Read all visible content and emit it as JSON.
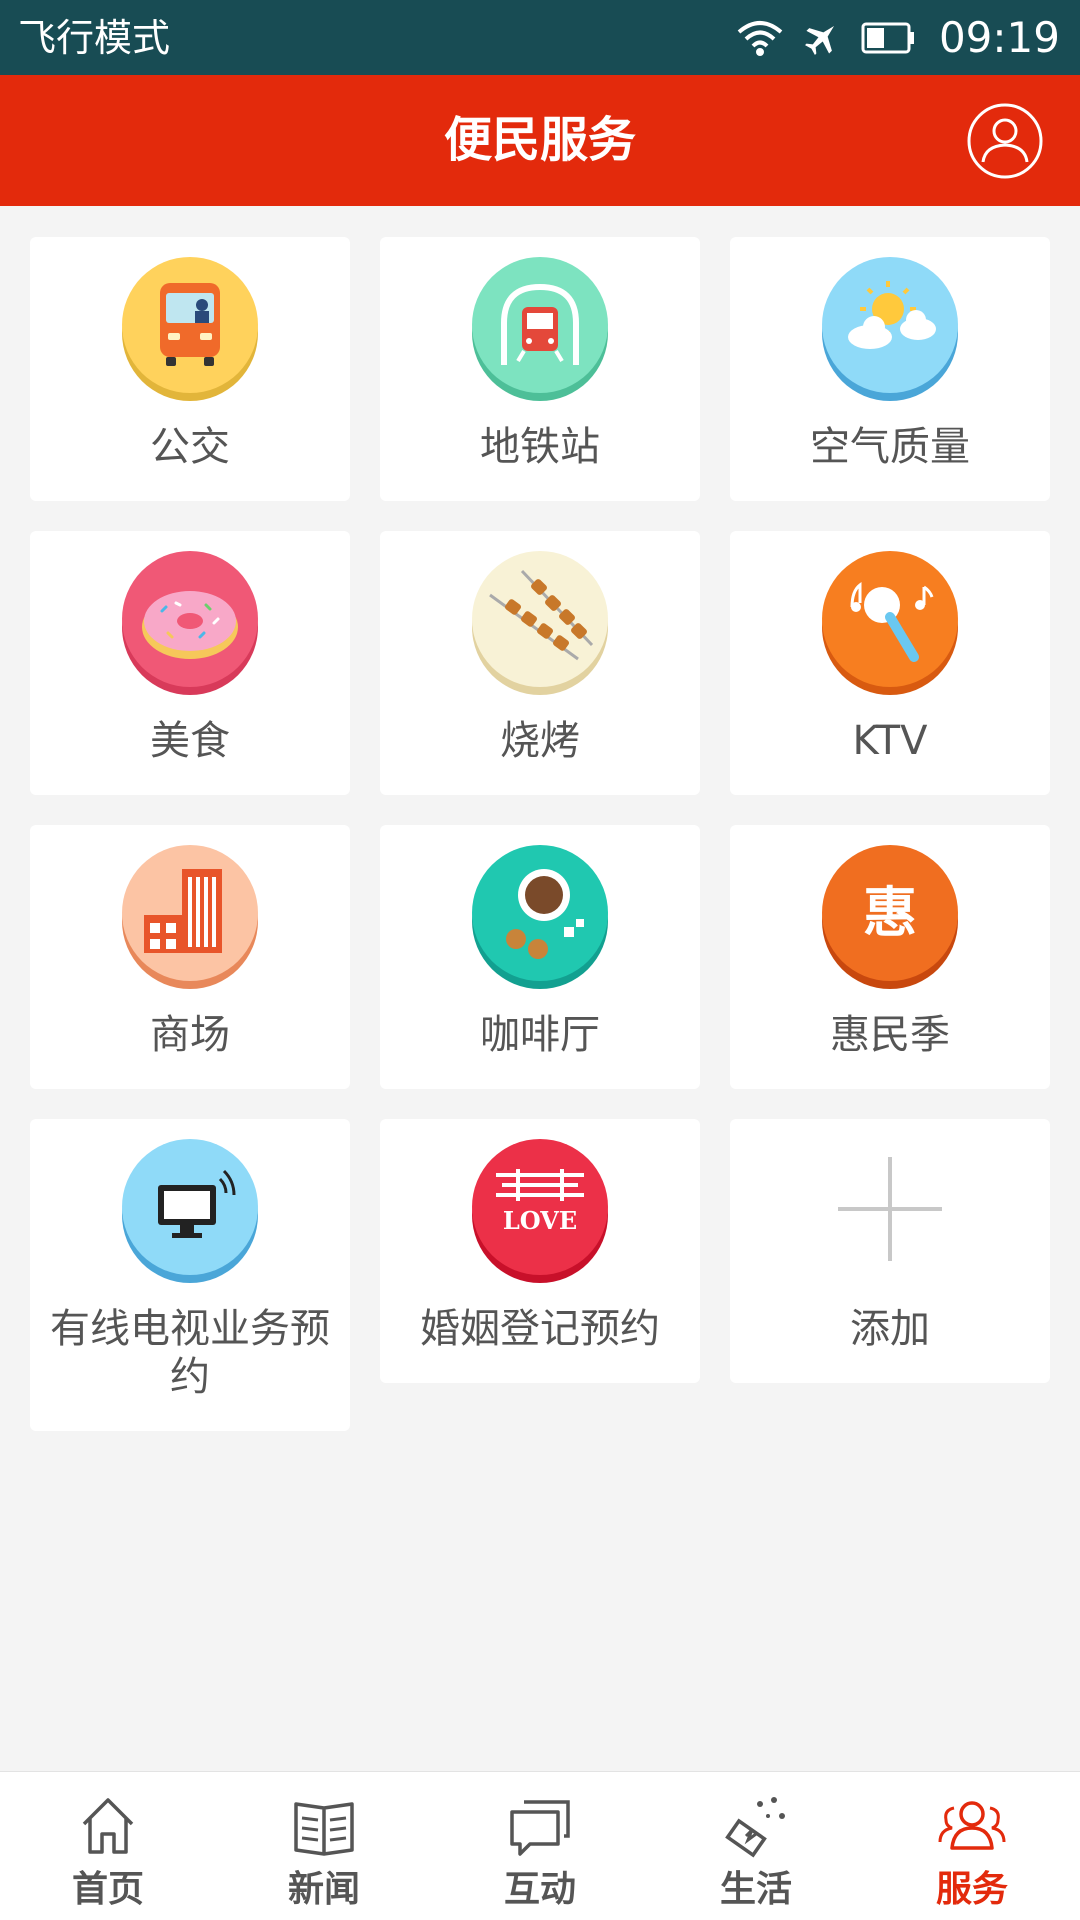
{
  "status_bar": {
    "mode": "飞行模式",
    "time": "09:19"
  },
  "header": {
    "title": "便民服务"
  },
  "services": [
    {
      "label": "公交",
      "icon": "bus-icon"
    },
    {
      "label": "地铁站",
      "icon": "subway-icon"
    },
    {
      "label": "空气质量",
      "icon": "weather-icon"
    },
    {
      "label": "美食",
      "icon": "donut-icon"
    },
    {
      "label": "烧烤",
      "icon": "barbecue-icon"
    },
    {
      "label": "KTV",
      "icon": "microphone-icon"
    },
    {
      "label": "商场",
      "icon": "mall-building-icon"
    },
    {
      "label": "咖啡厅",
      "icon": "coffee-icon"
    },
    {
      "label": "惠民季",
      "icon": "hui-icon",
      "icon_text": "惠"
    },
    {
      "label": "有线电视业务预约",
      "icon": "tv-icon"
    },
    {
      "label": "婚姻登记预约",
      "icon": "wedding-love-icon",
      "icon_text": "LOVE"
    },
    {
      "label": "添加",
      "icon": "plus-icon"
    }
  ],
  "bottom_nav": [
    {
      "label": "首页",
      "icon": "home-icon"
    },
    {
      "label": "新闻",
      "icon": "news-icon"
    },
    {
      "label": "互动",
      "icon": "chat-icon"
    },
    {
      "label": "生活",
      "icon": "life-icon"
    },
    {
      "label": "服务",
      "icon": "service-people-icon",
      "active": true
    }
  ],
  "colors": {
    "status_bar": "#184c54",
    "header": "#e32a0c",
    "active_tab": "#e32a0c",
    "background": "#f4f4f4"
  }
}
